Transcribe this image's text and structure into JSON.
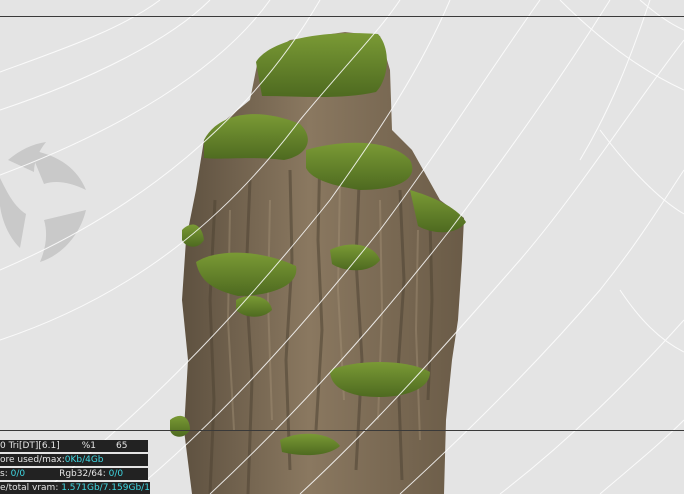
{
  "viewport": {
    "background_color": "#e4e4e4",
    "overlay_line_color": "#ffffff",
    "frame_line_color": "#3a3a3a",
    "logo_icon": "octane-render-logo-icon"
  },
  "stats": {
    "row1": {
      "label": "0 Tri[DT][6.1]",
      "sample": "%1",
      "value": "65"
    },
    "row2": {
      "label": "ore used/max:",
      "value": "0Kb/4Gb"
    },
    "row3": {
      "label_a": "s: ",
      "value_a": "0/0",
      "label_b": "Rgb32/64: ",
      "value_b": "0/0"
    },
    "row4": {
      "label": "e/total vram: ",
      "value": "1.571Gb/7.159Gb/1."
    }
  },
  "colors": {
    "panel_bg": "#222222",
    "panel_text": "#e6e6e6",
    "highlight": "#3fd7e2",
    "rock_base": "#7a6a55",
    "moss": "#5f7a2a"
  }
}
